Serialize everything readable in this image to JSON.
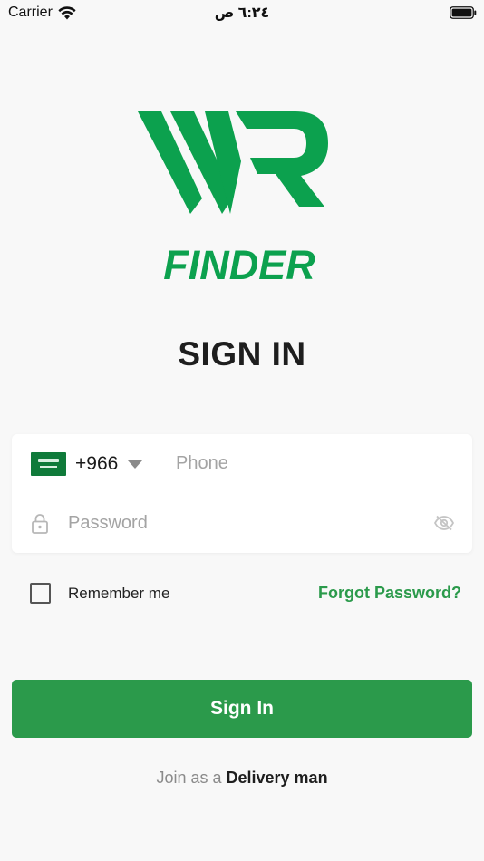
{
  "status_bar": {
    "carrier": "Carrier",
    "time": "٦:٢٤ ص"
  },
  "logo": {
    "wordmark": "FINDER",
    "brand_color": "#0ca14e"
  },
  "page_title": "SIGN IN",
  "form": {
    "country_code": "+966",
    "country_flag_icon": "saudi-arabia-flag-icon",
    "phone_placeholder": "Phone",
    "password_placeholder": "Password"
  },
  "remember_label": "Remember me",
  "forgot_label": "Forgot Password?",
  "sign_in_label": "Sign In",
  "join": {
    "prefix": "Join as a",
    "link_label": "Delivery man"
  },
  "colors": {
    "accent": "#2b9a4b",
    "background": "#f8f8f8"
  }
}
